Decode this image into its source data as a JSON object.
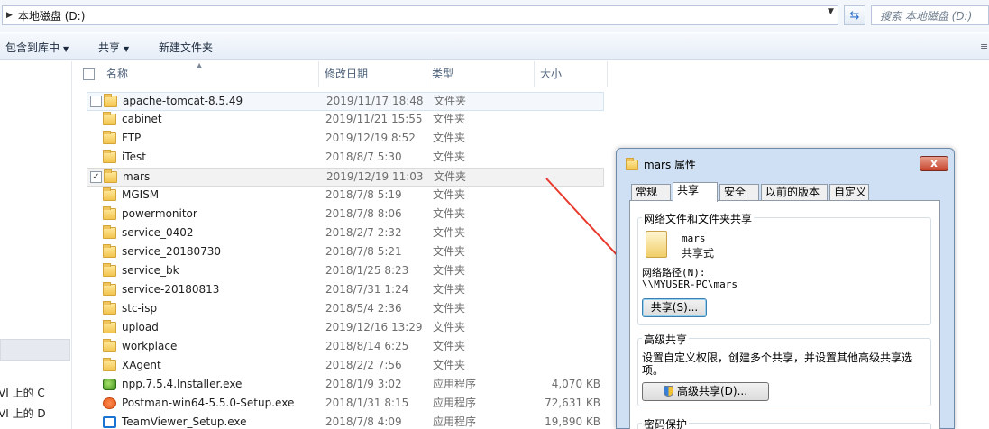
{
  "address": {
    "path": "本地磁盘 (D:)",
    "search_placeholder": "搜索 本地磁盘 (D:)"
  },
  "toolbar": {
    "include": "包含到库中",
    "share": "共享",
    "new_folder": "新建文件夹"
  },
  "nav": {
    "items": [
      "VI 上的 C",
      "VI 上的 D"
    ]
  },
  "columns": {
    "name": "名称",
    "date": "修改日期",
    "type": "类型",
    "size": "大小"
  },
  "files": [
    {
      "name": "apache-tomcat-8.5.49",
      "date": "2019/11/17 18:48",
      "type": "文件夹",
      "size": "",
      "icon": "folder-icon"
    },
    {
      "name": "cabinet",
      "date": "2019/11/21 15:55",
      "type": "文件夹",
      "size": "",
      "icon": "folder-icon"
    },
    {
      "name": "FTP",
      "date": "2019/12/19 8:52",
      "type": "文件夹",
      "size": "",
      "icon": "folder-icon"
    },
    {
      "name": "iTest",
      "date": "2018/8/7 5:30",
      "type": "文件夹",
      "size": "",
      "icon": "folder-icon"
    },
    {
      "name": "mars",
      "date": "2019/12/19 11:03",
      "type": "文件夹",
      "size": "",
      "icon": "folder-icon",
      "checked": true
    },
    {
      "name": "MGISM",
      "date": "2018/7/8 5:19",
      "type": "文件夹",
      "size": "",
      "icon": "folder-icon"
    },
    {
      "name": "powermonitor",
      "date": "2018/7/8 8:06",
      "type": "文件夹",
      "size": "",
      "icon": "folder-icon"
    },
    {
      "name": "service_0402",
      "date": "2018/2/7 2:32",
      "type": "文件夹",
      "size": "",
      "icon": "folder-icon"
    },
    {
      "name": "service_20180730",
      "date": "2018/7/8 5:21",
      "type": "文件夹",
      "size": "",
      "icon": "folder-icon"
    },
    {
      "name": "service_bk",
      "date": "2018/1/25 8:23",
      "type": "文件夹",
      "size": "",
      "icon": "folder-icon"
    },
    {
      "name": "service-20180813",
      "date": "2018/7/31 1:24",
      "type": "文件夹",
      "size": "",
      "icon": "folder-icon"
    },
    {
      "name": "stc-isp",
      "date": "2018/5/4 2:36",
      "type": "文件夹",
      "size": "",
      "icon": "folder-icon"
    },
    {
      "name": "upload",
      "date": "2019/12/16 13:29",
      "type": "文件夹",
      "size": "",
      "icon": "folder-icon"
    },
    {
      "name": "workplace",
      "date": "2018/8/14 6:25",
      "type": "文件夹",
      "size": "",
      "icon": "folder-icon"
    },
    {
      "name": "XAgent",
      "date": "2018/2/2 7:56",
      "type": "文件夹",
      "size": "",
      "icon": "folder-icon"
    },
    {
      "name": "npp.7.5.4.Installer.exe",
      "date": "2018/1/9 3:02",
      "type": "应用程序",
      "size": "4,070 KB",
      "icon": "notepadpp-icon"
    },
    {
      "name": "Postman-win64-5.5.0-Setup.exe",
      "date": "2018/1/31 8:15",
      "type": "应用程序",
      "size": "72,631 KB",
      "icon": "postman-icon"
    },
    {
      "name": "TeamViewer_Setup.exe",
      "date": "2018/7/8 4:09",
      "type": "应用程序",
      "size": "19,890 KB",
      "icon": "teamviewer-icon"
    }
  ],
  "dialog": {
    "title": "mars 属性",
    "close": "x",
    "tabs": [
      "常规",
      "共享",
      "安全",
      "以前的版本",
      "自定义"
    ],
    "network_group": "网络文件和文件夹共享",
    "folder_name": "mars",
    "share_status": "共享式",
    "net_path_label": "网络路径(N):",
    "net_path": "\\\\MYUSER-PC\\mars",
    "share_button": "共享(S)...",
    "advanced_group": "高级共享",
    "advanced_desc": "设置自定义权限，创建多个共享，并设置其他高级共享选项。",
    "advanced_button": "高级共享(D)...",
    "password_group": "密码保护"
  }
}
